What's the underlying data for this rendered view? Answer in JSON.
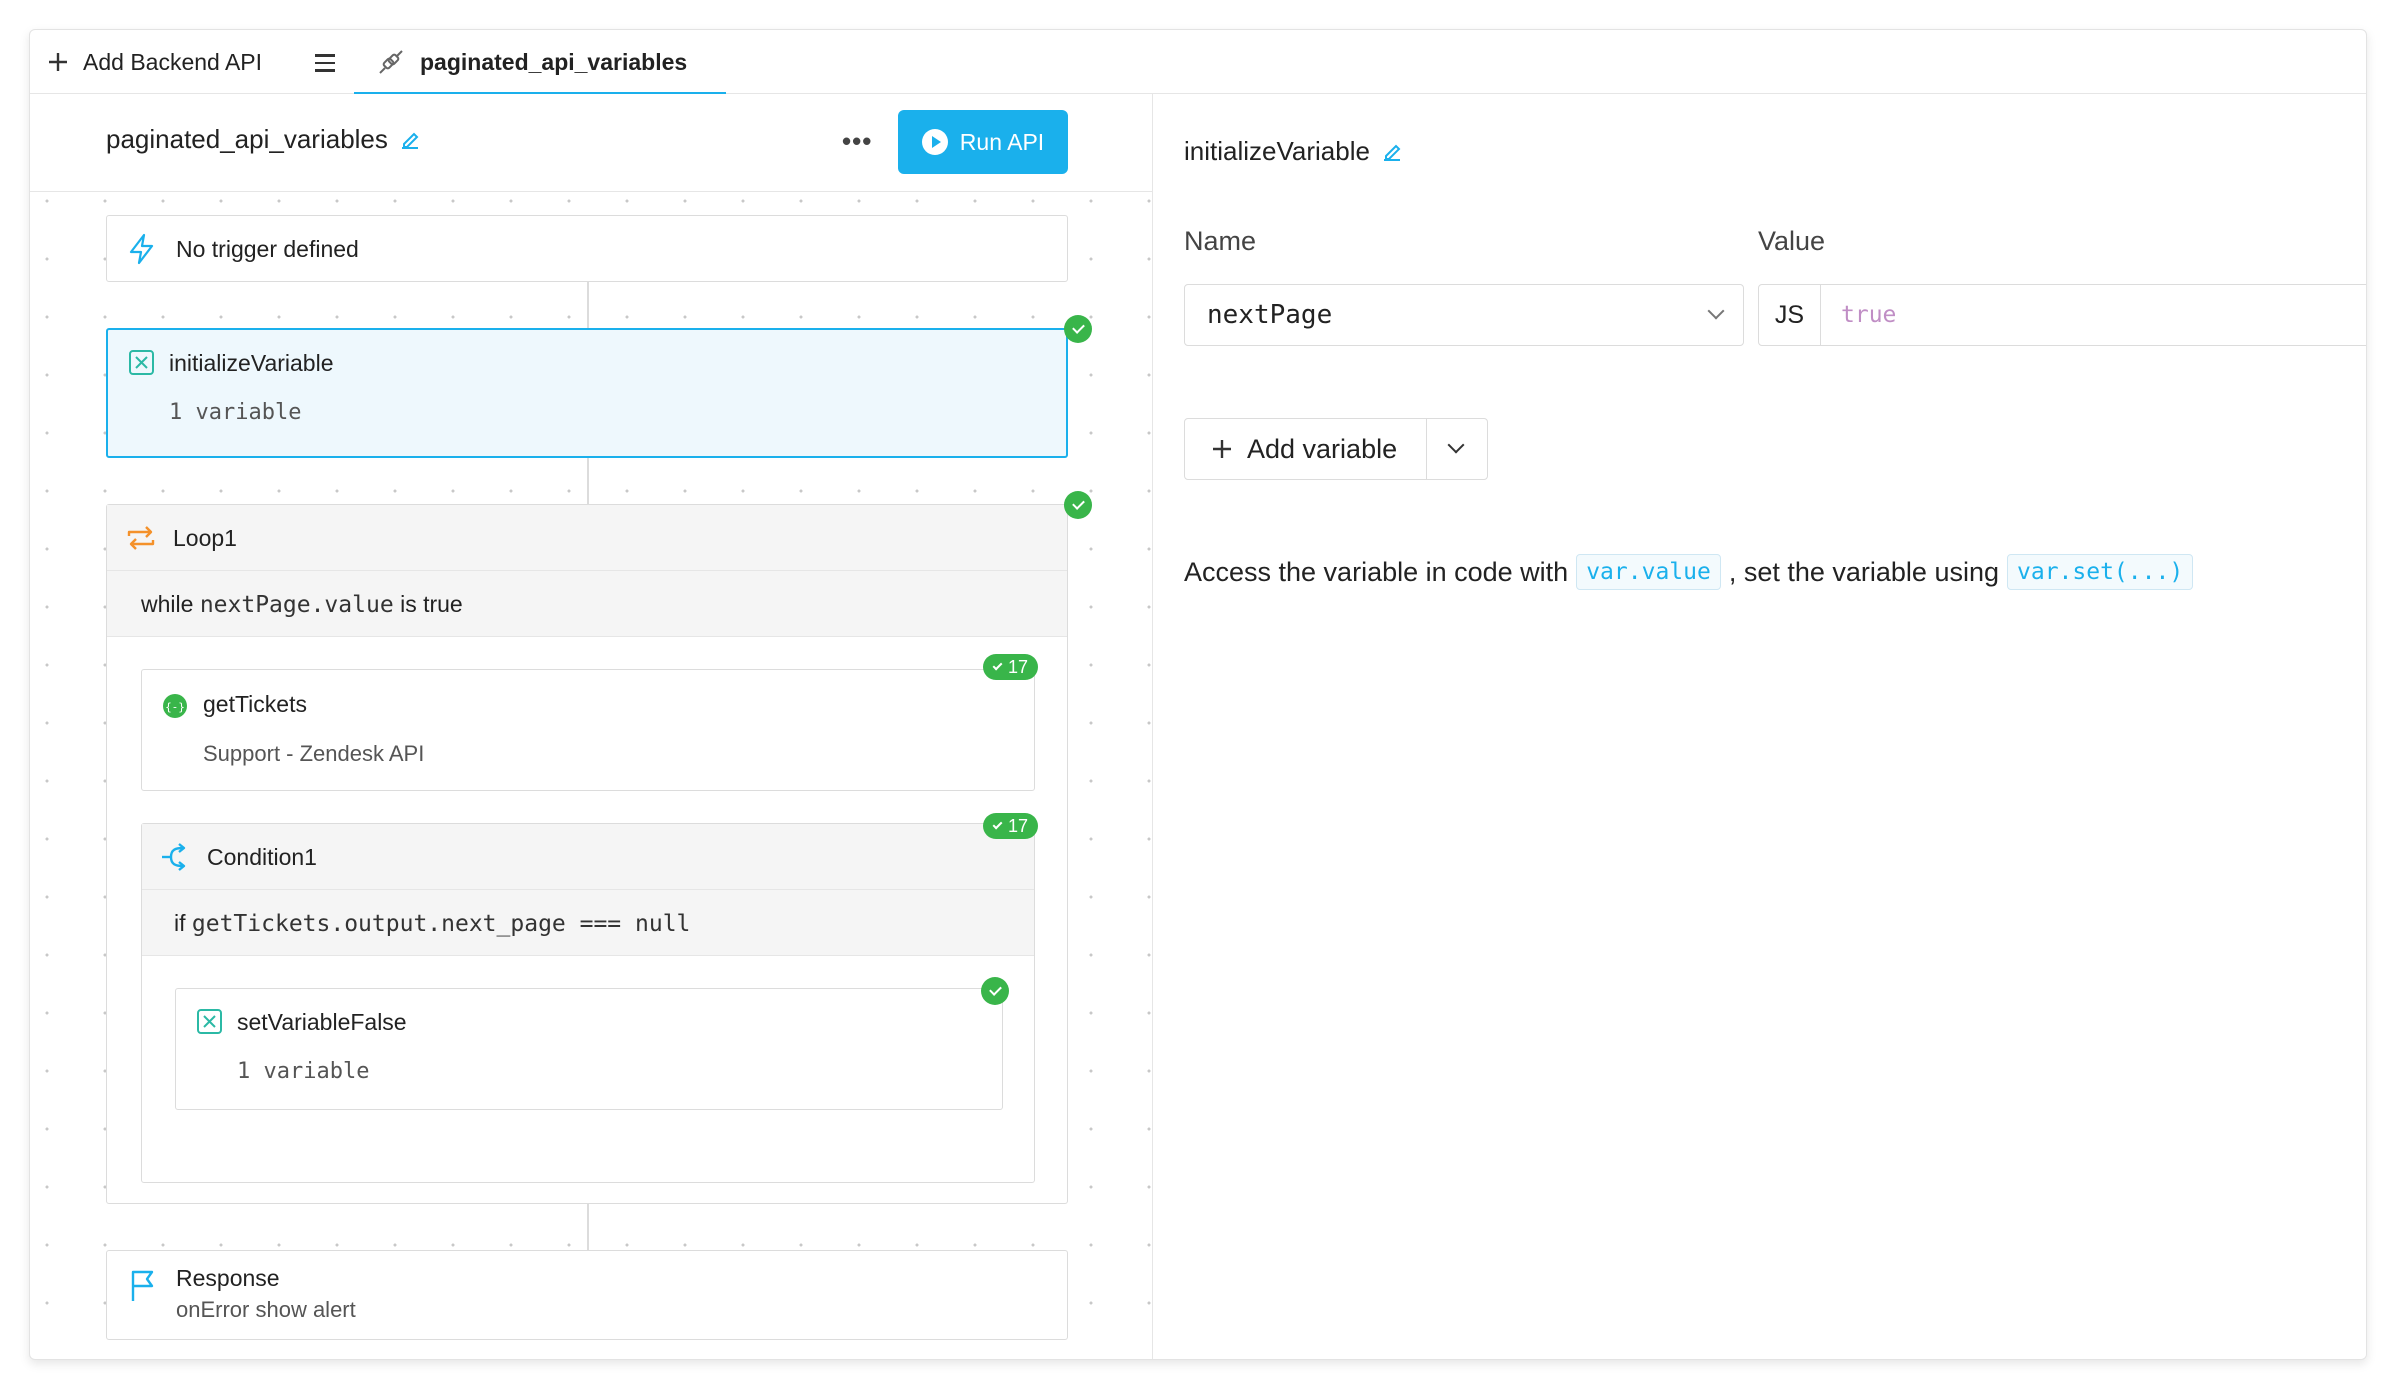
{
  "tabbar": {
    "add_label": "Add Backend API",
    "active_tab": "paginated_api_variables"
  },
  "left": {
    "title": "paginated_api_variables",
    "more": "•••",
    "run_label": "Run API",
    "trigger": {
      "label": "No trigger defined"
    },
    "init": {
      "title": "initializeVariable",
      "subtitle": "1 variable"
    },
    "loop": {
      "title": "Loop1",
      "cond_prefix": "while",
      "cond_code": "nextPage.value",
      "cond_suffix": "is true"
    },
    "get_tickets": {
      "title": "getTickets",
      "subtitle": "Support - Zendesk API",
      "count": "17"
    },
    "condition": {
      "title": "Condition1",
      "prefix": "if",
      "code": "getTickets.output.next_page === null",
      "count": "17"
    },
    "set_false": {
      "title": "setVariableFalse",
      "subtitle": "1 variable"
    },
    "response": {
      "title": "Response",
      "subtitle": "onError show alert"
    }
  },
  "right": {
    "title": "initializeVariable",
    "name_label": "Name",
    "value_label": "Value",
    "name_value": "nextPage",
    "value_mode": "JS",
    "value_value": "true",
    "add_var_label": "Add variable",
    "help_prefix": "Access the variable in code with",
    "help_code1": "var.value",
    "help_middle": ", set the variable using",
    "help_code2": "var.set(...)"
  },
  "colors": {
    "accent": "#1ab0ec",
    "success": "#39b54a",
    "loop": "#f4912a"
  }
}
